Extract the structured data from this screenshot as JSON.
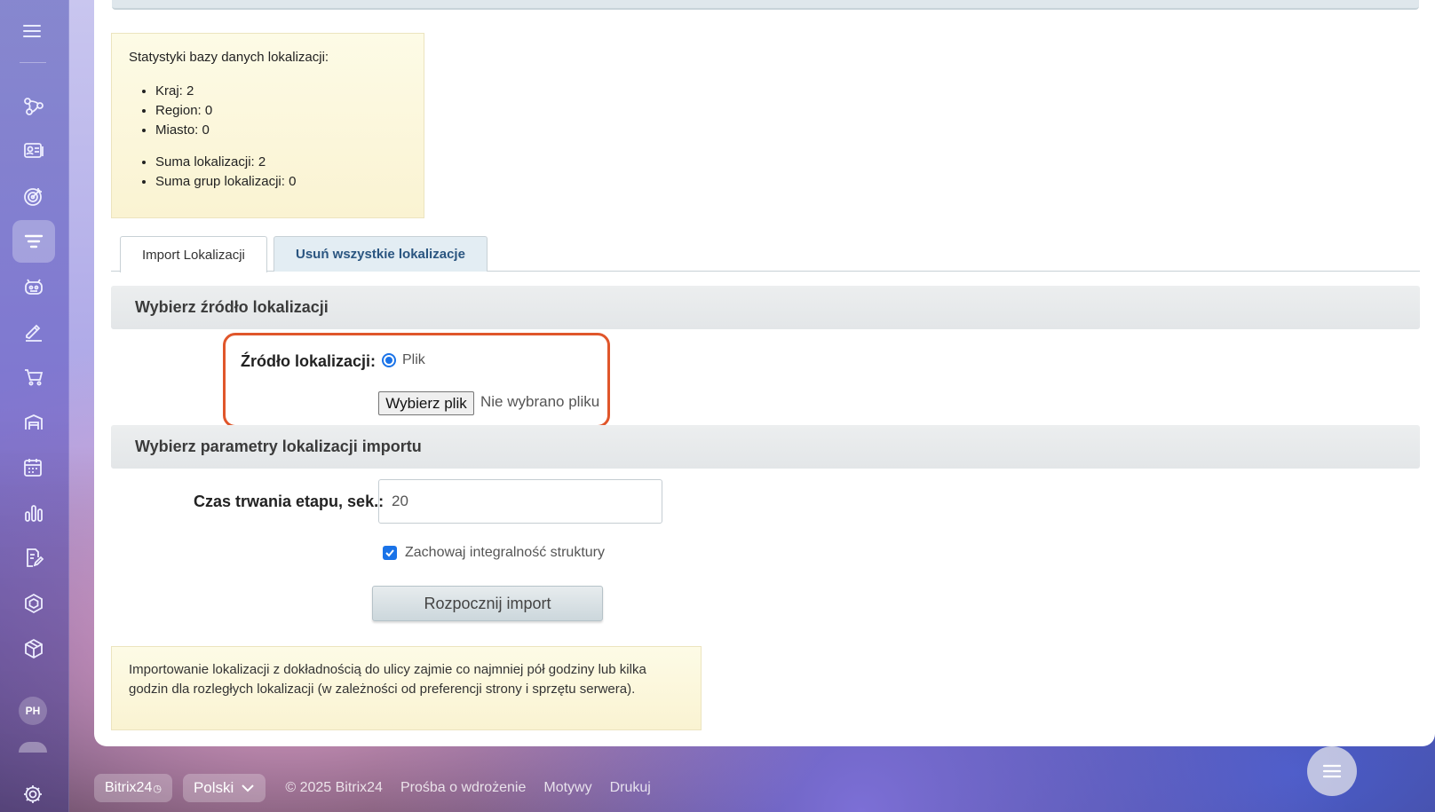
{
  "sidebar": {
    "items": [
      {
        "icon": "network-icon",
        "name": "sidebar-item-network"
      },
      {
        "icon": "contacts-icon",
        "name": "sidebar-item-contacts"
      },
      {
        "icon": "target-icon",
        "name": "sidebar-item-target"
      },
      {
        "icon": "filter-icon",
        "name": "sidebar-item-filter",
        "active": true
      },
      {
        "icon": "robot-icon",
        "name": "sidebar-item-robot"
      },
      {
        "icon": "pen-icon",
        "name": "sidebar-item-sign"
      },
      {
        "icon": "cart-icon",
        "name": "sidebar-item-shop"
      },
      {
        "icon": "warehouse-icon",
        "name": "sidebar-item-warehouse"
      },
      {
        "icon": "calendar-icon",
        "name": "sidebar-item-calendar"
      },
      {
        "icon": "chart-icon",
        "name": "sidebar-item-analytics"
      },
      {
        "icon": "document-edit-icon",
        "name": "sidebar-item-documents"
      },
      {
        "icon": "hexagon-icon",
        "name": "sidebar-item-marketplace"
      },
      {
        "icon": "box-icon",
        "name": "sidebar-item-products"
      }
    ],
    "avatar_initials": "PH"
  },
  "stats": {
    "title": "Statystyki bazy danych lokalizacji:",
    "group1": [
      "Kraj: 2",
      "Region: 0",
      "Miasto: 0"
    ],
    "group2": [
      "Suma lokalizacji: 2",
      "Suma grup lokalizacji: 0"
    ]
  },
  "tabs": [
    {
      "label": "Import Lokalizacji",
      "active": true
    },
    {
      "label": "Usuń wszystkie lokalizacje",
      "active": false
    }
  ],
  "source_section": {
    "heading": "Wybierz źródło lokalizacji",
    "label": "Źródło lokalizacji:",
    "radio_label": "Plik",
    "file_button": "Wybierz plik",
    "file_status": "Nie wybrano pliku"
  },
  "params_section": {
    "heading": "Wybierz parametry lokalizacji importu",
    "duration_label": "Czas trwania etapu, sek.:",
    "duration_value": "20",
    "integrity_label": "Zachowaj integralność struktury",
    "integrity_checked": true,
    "start_button": "Rozpocznij import"
  },
  "note": "Importowanie lokalizacji z dokładnością do ulicy zajmie co najmniej pół godziny lub kilka godzin dla rozległych lokalizacji (w zależności od preferencji strony i sprzętu serwera).",
  "footer": {
    "brand": "Bitrix24",
    "language": "Polski",
    "copyright": "© 2025 Bitrix24",
    "links": [
      "Prośba o wdrożenie",
      "Motywy",
      "Drukuj"
    ]
  },
  "colors": {
    "highlight": "#e0562b",
    "accent": "#1a73e8",
    "tab_link": "#2a5580"
  }
}
